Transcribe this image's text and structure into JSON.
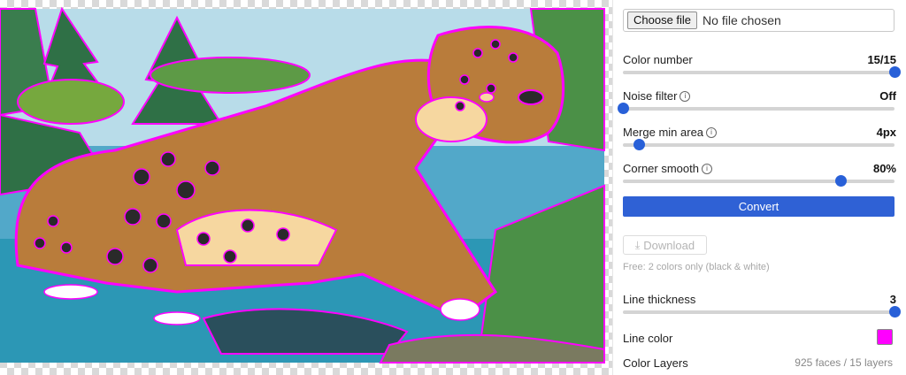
{
  "file": {
    "button_label": "Choose file",
    "status": "No file chosen"
  },
  "sliders": [
    {
      "key": "color_number",
      "label": "Color number",
      "value": "15/15",
      "fraction": 1.0,
      "info": false
    },
    {
      "key": "noise_filter",
      "label": "Noise filter",
      "value": "Off",
      "fraction": 0.0,
      "info": true
    },
    {
      "key": "merge_min_area",
      "label": "Merge min area",
      "value": "4px",
      "fraction": 0.06,
      "info": true
    },
    {
      "key": "corner_smooth",
      "label": "Corner smooth",
      "value": "80%",
      "fraction": 0.8,
      "info": true
    }
  ],
  "convert_label": "Convert",
  "download_label": "Download",
  "free_note": "Free: 2 colors only (black & white)",
  "line_thickness": {
    "label": "Line thickness",
    "value": "3",
    "fraction": 1.0
  },
  "line_color": {
    "label": "Line color",
    "color": "#ff00ff"
  },
  "color_layers": {
    "label": "Color Layers",
    "info": "925 faces / 15 layers"
  },
  "colors": {
    "accent": "#2f61d5",
    "outline": "#ff00ff"
  }
}
